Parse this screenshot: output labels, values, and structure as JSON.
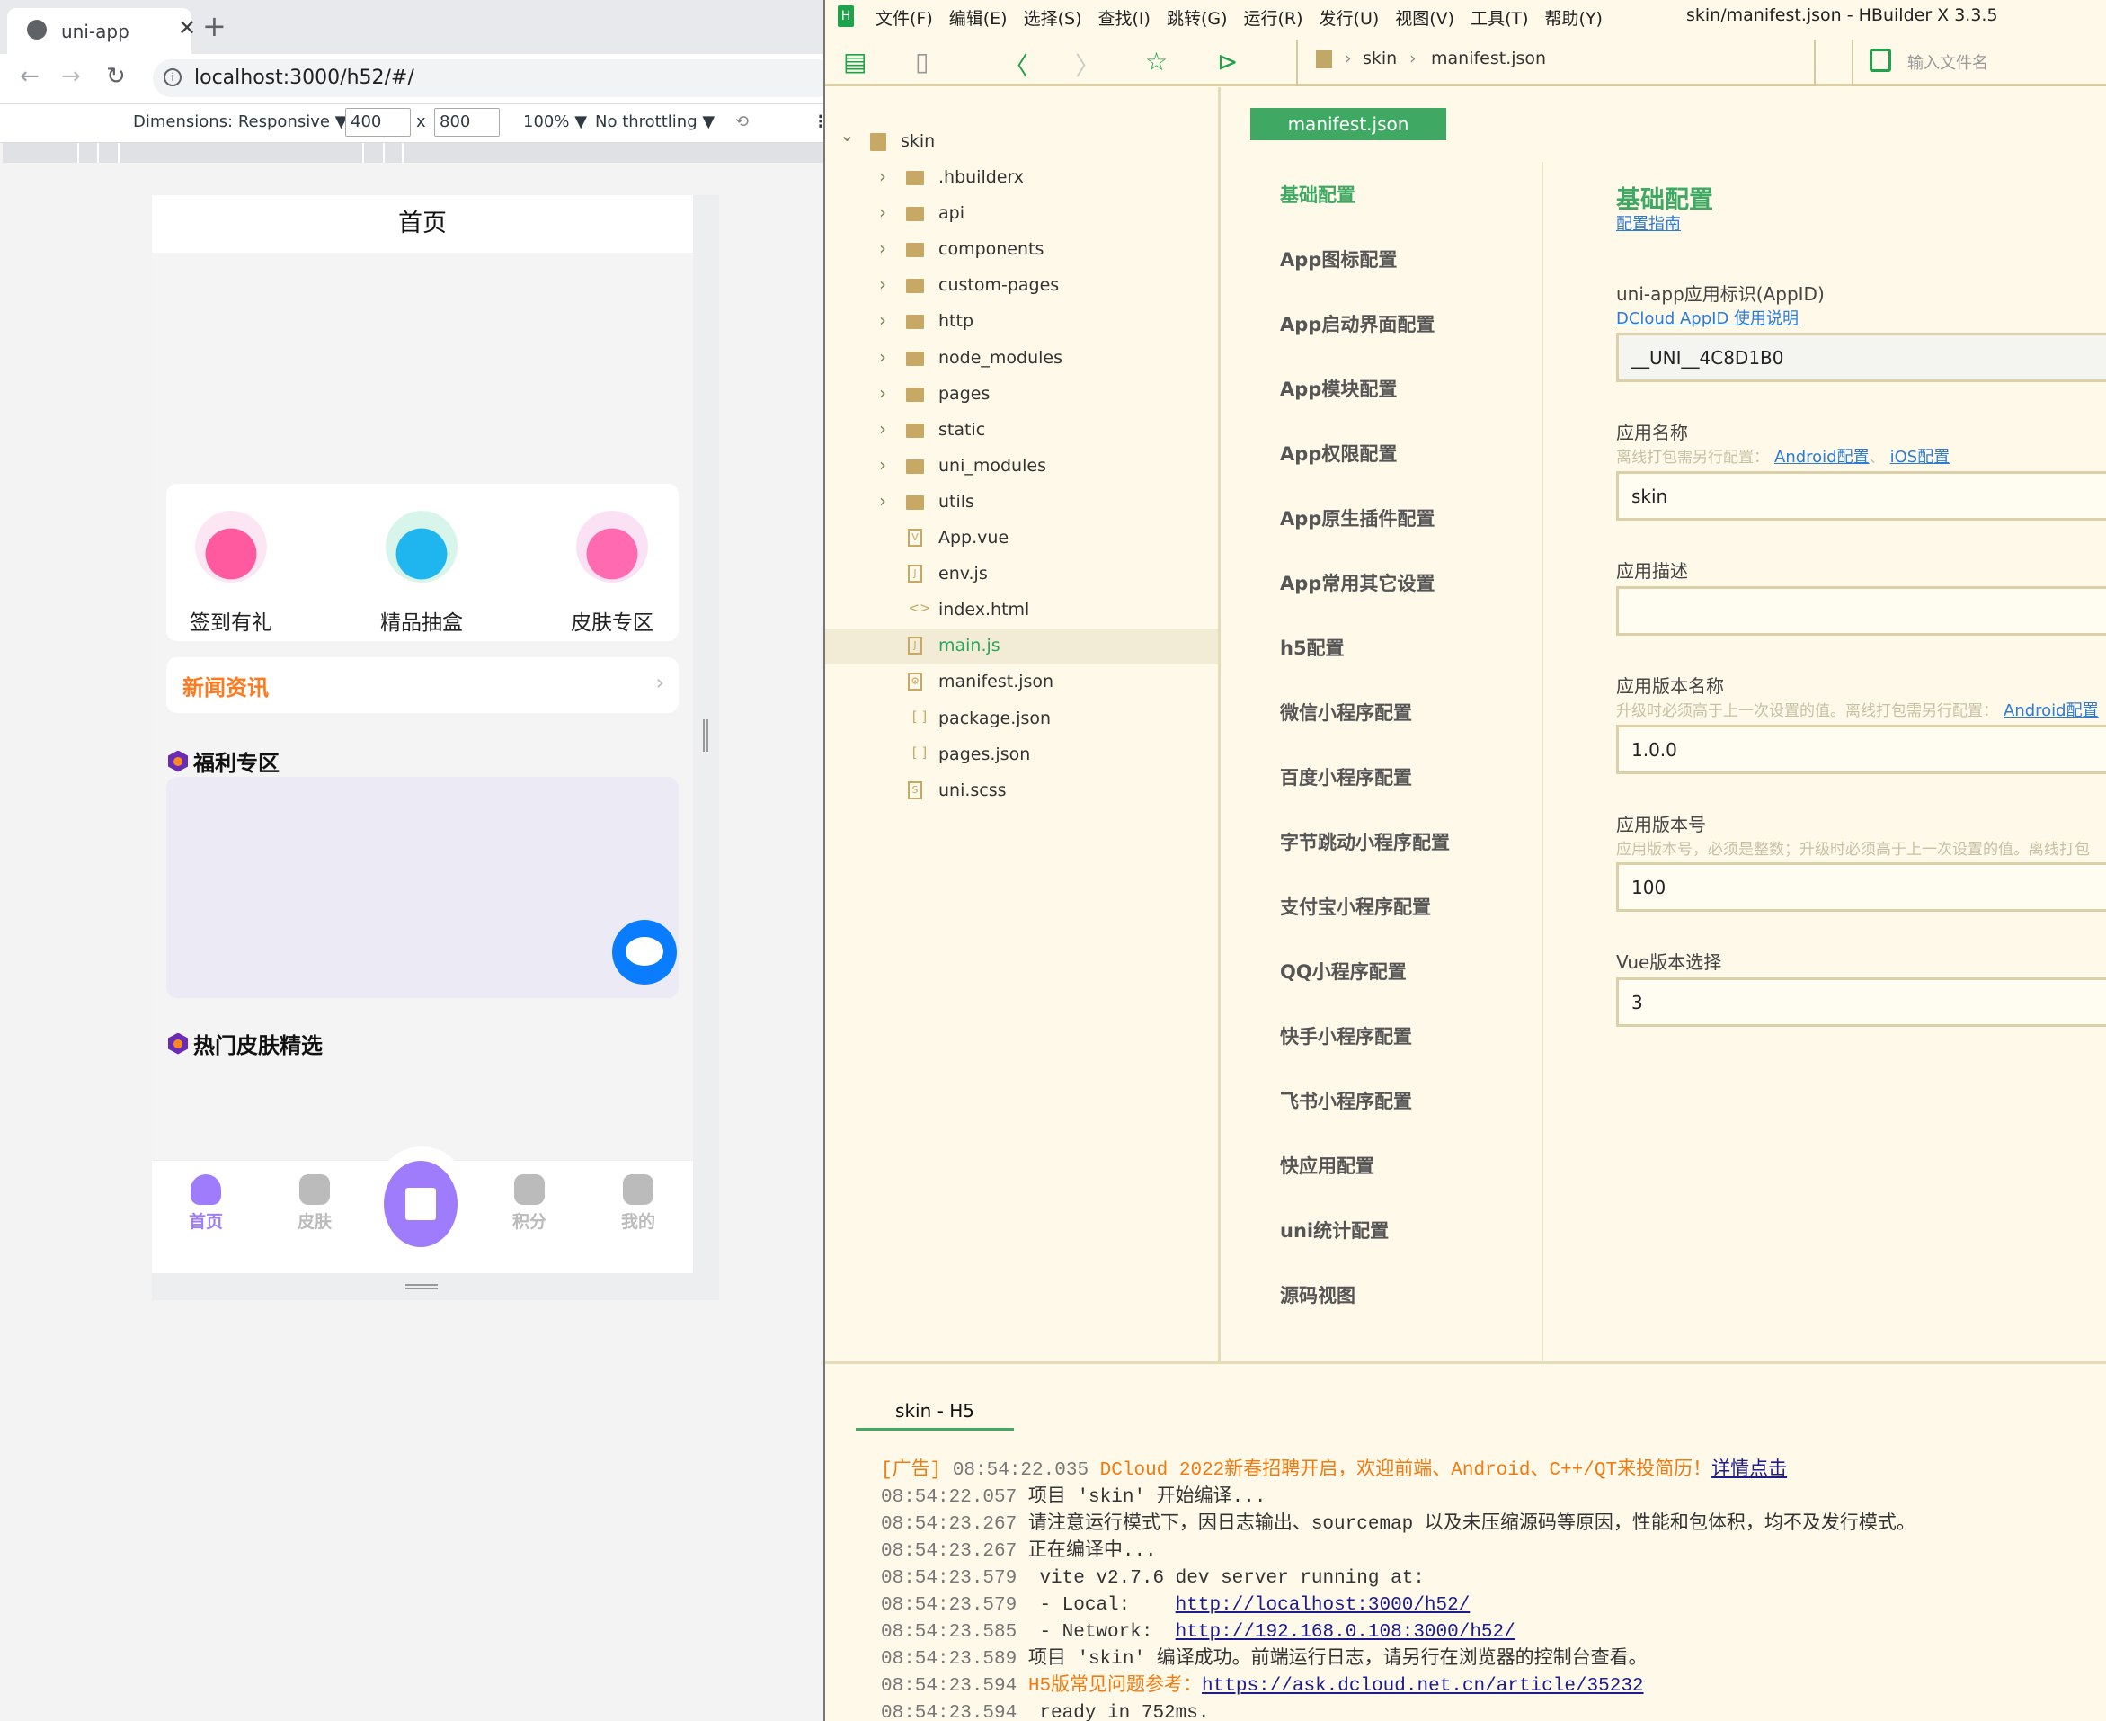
{
  "browser": {
    "tab_title": "uni-app",
    "url": "localhost:3000/h52/#/",
    "device_toolbar": {
      "dimensions": "Dimensions: Responsive",
      "width": "400",
      "times": "x",
      "height": "800",
      "zoom": "100%",
      "throttling": "No throttling"
    }
  },
  "phone": {
    "header_title": "首页",
    "grid": [
      {
        "label": "签到有礼",
        "icon": "calendar-gift-icon"
      },
      {
        "label": "精品抽盒",
        "icon": "gift-box-icon"
      },
      {
        "label": "皮肤专区",
        "icon": "cart-icon"
      }
    ],
    "news_title": "新闻资讯",
    "section_welfare": "福利专区",
    "section_hot": "热门皮肤精选",
    "tabbar": [
      {
        "label": "首页",
        "active": true
      },
      {
        "label": "皮肤"
      },
      {
        "label": "积分"
      },
      {
        "label": "我的"
      }
    ],
    "colors": {
      "accent": "#9e7cfb",
      "news": "#ff7a1e",
      "chat": "#0a7cff"
    }
  },
  "hbuilder": {
    "menu": [
      "文件(F)",
      "编辑(E)",
      "选择(S)",
      "查找(I)",
      "跳转(G)",
      "运行(R)",
      "发行(U)",
      "视图(V)",
      "工具(T)",
      "帮助(Y)"
    ],
    "window_title": "skin/manifest.json - HBuilder X 3.3.5",
    "breadcrumb": [
      "skin",
      "manifest.json"
    ],
    "search_placeholder": "输入文件名",
    "tree": {
      "root": "skin",
      "items": [
        {
          "name": ".hbuilderx",
          "type": "folder"
        },
        {
          "name": "api",
          "type": "folder"
        },
        {
          "name": "components",
          "type": "folder"
        },
        {
          "name": "custom-pages",
          "type": "folder"
        },
        {
          "name": "http",
          "type": "folder"
        },
        {
          "name": "node_modules",
          "type": "folder"
        },
        {
          "name": "pages",
          "type": "folder"
        },
        {
          "name": "static",
          "type": "folder"
        },
        {
          "name": "uni_modules",
          "type": "folder"
        },
        {
          "name": "utils",
          "type": "folder"
        },
        {
          "name": "App.vue",
          "type": "vue"
        },
        {
          "name": "env.js",
          "type": "js"
        },
        {
          "name": "index.html",
          "type": "html"
        },
        {
          "name": "main.js",
          "type": "js",
          "selected": true
        },
        {
          "name": "manifest.json",
          "type": "manifest"
        },
        {
          "name": "package.json",
          "type": "json"
        },
        {
          "name": "pages.json",
          "type": "json"
        },
        {
          "name": "uni.scss",
          "type": "scss"
        }
      ]
    },
    "editor_tab": "manifest.json",
    "nav": [
      "基础配置",
      "App图标配置",
      "App启动界面配置",
      "App模块配置",
      "App权限配置",
      "App原生插件配置",
      "App常用其它设置",
      "h5配置",
      "微信小程序配置",
      "百度小程序配置",
      "字节跳动小程序配置",
      "支付宝小程序配置",
      "QQ小程序配置",
      "快手小程序配置",
      "飞书小程序配置",
      "快应用配置",
      "uni统计配置",
      "源码视图"
    ],
    "form": {
      "heading": "基础配置",
      "guide_link": "配置指南",
      "fields": [
        {
          "label": "uni-app应用标识(AppID)",
          "links": [
            "DCloud AppID 使用说明"
          ],
          "value": "__UNI__4C8D1B0",
          "readonly": true
        },
        {
          "label": "应用名称",
          "hint": "离线打包需另行配置：",
          "links": [
            "Android配置",
            "iOS配置"
          ],
          "value": "skin"
        },
        {
          "label": "应用描述",
          "value": ""
        },
        {
          "label": "应用版本名称",
          "hint": "升级时必须高于上一次设置的值。离线打包需另行配置：",
          "links": [
            "Android配置"
          ],
          "value": "1.0.0"
        },
        {
          "label": "应用版本号",
          "hint": "应用版本号，必须是整数；升级时必须高于上一次设置的值。离线打包",
          "value": "100"
        },
        {
          "label": "Vue版本选择",
          "value": "3"
        }
      ]
    },
    "console": {
      "tab": "skin - H5",
      "lines": [
        [
          {
            "t": "[广告]",
            "k": "orange"
          },
          {
            "t": " 08:54:22.035 ",
            "k": "time"
          },
          {
            "t": "DCloud 2022新春招聘开启，欢迎前端、Android、C++/QT来投简历！",
            "k": "orange"
          },
          {
            "t": "详情点击",
            "k": "link"
          }
        ],
        [
          {
            "t": "08:54:22.057",
            "k": "time"
          },
          {
            "t": " 项目 'skin' 开始编译...",
            "k": "msg"
          }
        ],
        [
          {
            "t": "08:54:23.267",
            "k": "time"
          },
          {
            "t": " 请注意运行模式下，因日志输出、sourcemap 以及未压缩源码等原因，性能和包体积，均不及发行模式。",
            "k": "msg"
          }
        ],
        [
          {
            "t": "08:54:23.267",
            "k": "time"
          },
          {
            "t": " 正在编译中...",
            "k": "msg"
          }
        ],
        [
          {
            "t": "08:54:23.579",
            "k": "time"
          },
          {
            "t": "  vite v2.7.6 dev server running at:",
            "k": "msg"
          }
        ],
        [
          {
            "t": "08:54:23.579",
            "k": "time"
          },
          {
            "t": "  - Local:    ",
            "k": "msg"
          },
          {
            "t": "http://localhost:3000/h52/",
            "k": "link"
          }
        ],
        [
          {
            "t": "08:54:23.585",
            "k": "time"
          },
          {
            "t": "  - Network:  ",
            "k": "msg"
          },
          {
            "t": "http://192.168.0.108:3000/h52/",
            "k": "link"
          }
        ],
        [
          {
            "t": "08:54:23.589",
            "k": "time"
          },
          {
            "t": " 项目 'skin' 编译成功。前端运行日志，请另行在浏览器的控制台查看。",
            "k": "msg"
          }
        ],
        [
          {
            "t": "08:54:23.594",
            "k": "time"
          },
          {
            "t": " H5版常见问题参考：",
            "k": "orange"
          },
          {
            "t": "https://ask.dcloud.net.cn/article/35232",
            "k": "link"
          }
        ],
        [
          {
            "t": "08:54:23.594",
            "k": "time"
          },
          {
            "t": "  ready in 752ms.",
            "k": "msg"
          }
        ]
      ]
    }
  }
}
